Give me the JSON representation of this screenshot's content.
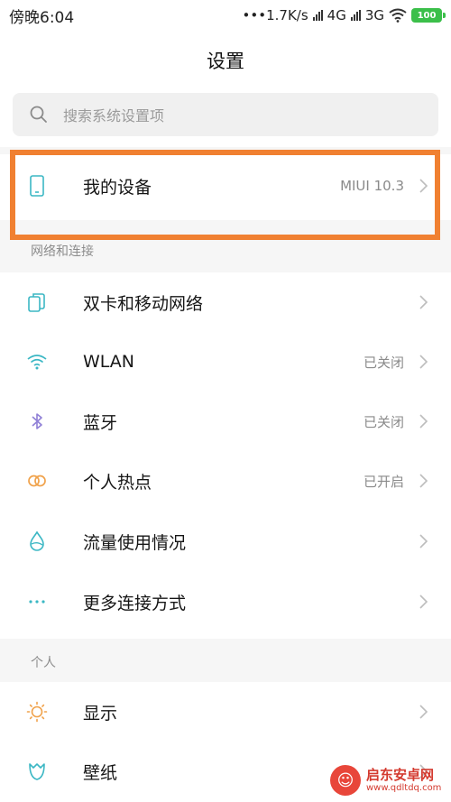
{
  "status_bar": {
    "time": "傍晚6:04",
    "speed": "•••1.7K/s",
    "network1": "4G",
    "network2": "3G",
    "battery": "100"
  },
  "header": {
    "title": "设置"
  },
  "search": {
    "placeholder": "搜索系统设置项"
  },
  "my_device": {
    "label": "我的设备",
    "value": "MIUI 10.3"
  },
  "sections": [
    {
      "header": "网络和连接",
      "items": [
        {
          "label": "双卡和移动网络",
          "value": ""
        },
        {
          "label": "WLAN",
          "value": "已关闭"
        },
        {
          "label": "蓝牙",
          "value": "已关闭"
        },
        {
          "label": "个人热点",
          "value": "已开启"
        },
        {
          "label": "流量使用情况",
          "value": ""
        },
        {
          "label": "更多连接方式",
          "value": ""
        }
      ]
    },
    {
      "header": "个人",
      "items": [
        {
          "label": "显示",
          "value": ""
        },
        {
          "label": "壁纸",
          "value": ""
        }
      ]
    }
  ],
  "watermark": {
    "name": "启东安卓网",
    "url": "www.qdltdq.com"
  },
  "colors": {
    "accent_icon": "#3bb7c4",
    "highlight_border": "#f08031",
    "battery": "#3bbf4a"
  }
}
